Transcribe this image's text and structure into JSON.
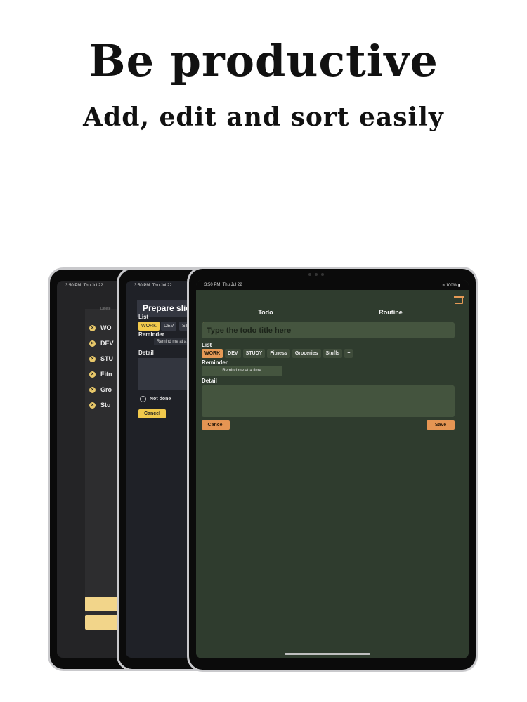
{
  "headline": "Be productive",
  "subhead": "Add, edit and sort easily",
  "status": {
    "time": "3:50 PM",
    "date": "Thu Jul 22",
    "battery": "100%"
  },
  "back_device": {
    "small_label": "Delete",
    "lists": [
      "WO",
      "DEV",
      "STU",
      "Fitn",
      "Gro",
      "Stu"
    ]
  },
  "mid_device": {
    "title": "Prepare slide",
    "list_label": "List",
    "chips": [
      "WORK",
      "DEV",
      "STU"
    ],
    "reminder_label": "Reminder",
    "reminder_value": "Remind me at a",
    "detail_label": "Detail",
    "not_done": "Not done",
    "cancel": "Cancel"
  },
  "front_device": {
    "tabs": [
      "Todo",
      "Routine"
    ],
    "title_placeholder": "Type the todo title here",
    "list_label": "List",
    "chips": [
      "WORK",
      "DEV",
      "STUDY",
      "Fitness",
      "Groceries",
      "Stuffs",
      "+"
    ],
    "reminder_label": "Reminder",
    "reminder_button": "Remind me at a time",
    "detail_label": "Detail",
    "cancel": "Cancel",
    "save": "Save"
  },
  "colors": {
    "accent": "#e59553",
    "front_bg": "#2f3c2e",
    "chip_yellow": "#f1c94c"
  }
}
